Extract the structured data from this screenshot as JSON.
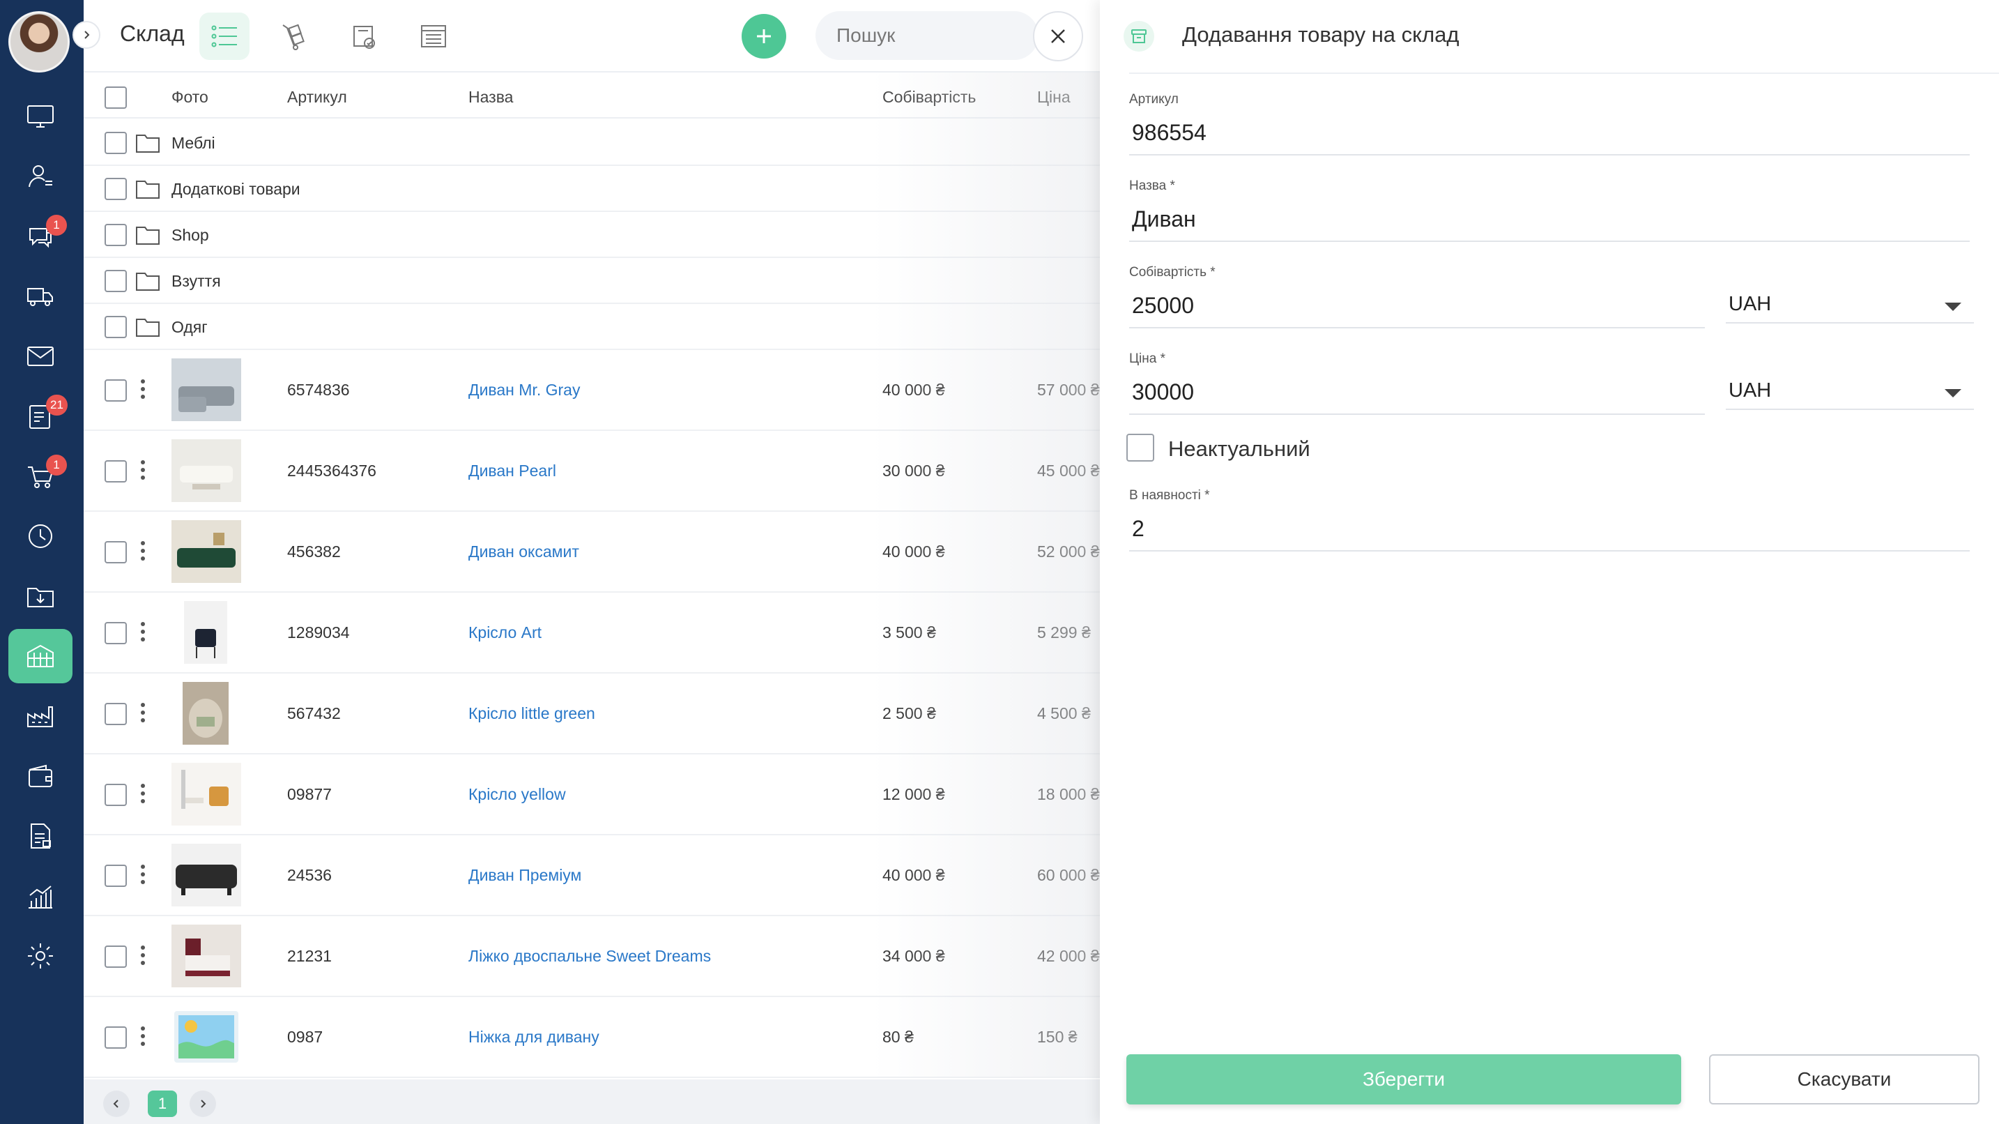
{
  "app": {
    "page_title": "Склад",
    "search_placeholder": "Пошук"
  },
  "sidebar": {
    "items": [
      {
        "icon": "monitor-icon",
        "badge": ""
      },
      {
        "icon": "contacts-icon",
        "badge": ""
      },
      {
        "icon": "chat-icon",
        "badge": "1"
      },
      {
        "icon": "delivery-truck-icon",
        "badge": ""
      },
      {
        "icon": "mail-icon",
        "badge": ""
      },
      {
        "icon": "notes-icon",
        "badge": "21"
      },
      {
        "icon": "cart-icon",
        "badge": "1"
      },
      {
        "icon": "clock-icon",
        "badge": ""
      },
      {
        "icon": "download-folder-icon",
        "badge": ""
      },
      {
        "icon": "warehouse-icon",
        "badge": "",
        "active": true
      },
      {
        "icon": "factory-icon",
        "badge": ""
      },
      {
        "icon": "wallet-icon",
        "badge": ""
      },
      {
        "icon": "documents-icon",
        "badge": ""
      },
      {
        "icon": "analytics-icon",
        "badge": ""
      },
      {
        "icon": "settings-icon",
        "badge": ""
      }
    ]
  },
  "table": {
    "headers": {
      "photo": "Фото",
      "sku": "Артикул",
      "name": "Назва",
      "cost": "Собівартість",
      "price": "Ціна"
    },
    "folders": [
      "Меблі",
      "Додаткові товари",
      "Shop",
      "Взуття",
      "Одяг"
    ],
    "items": [
      {
        "sku": "6574836",
        "name": "Диван Mr. Gray",
        "cost": "40 000 ₴",
        "price": "57 000 ₴"
      },
      {
        "sku": "2445364376",
        "name": "Диван Pearl",
        "cost": "30 000 ₴",
        "price": "45 000 ₴"
      },
      {
        "sku": "456382",
        "name": "Диван оксамит",
        "cost": "40 000 ₴",
        "price": "52 000 ₴"
      },
      {
        "sku": "1289034",
        "name": "Крісло Art",
        "cost": "3 500 ₴",
        "price": "5 299 ₴"
      },
      {
        "sku": "567432",
        "name": "Крісло little green",
        "cost": "2 500 ₴",
        "price": "4 500 ₴"
      },
      {
        "sku": "09877",
        "name": "Крісло yellow",
        "cost": "12 000 ₴",
        "price": "18 000 ₴"
      },
      {
        "sku": "24536",
        "name": "Диван Преміум",
        "cost": "40 000 ₴",
        "price": "60 000 ₴"
      },
      {
        "sku": "21231",
        "name": "Ліжко двоспальне Sweet Dreams",
        "cost": "34 000 ₴",
        "price": "42 000 ₴"
      },
      {
        "sku": "0987",
        "name": "Ніжка для дивану",
        "cost": "80 ₴",
        "price": "150 ₴"
      }
    ]
  },
  "pager": {
    "current": "1"
  },
  "panel": {
    "title": "Додавання товару на склад",
    "sku_label": "Артикул",
    "sku_value": "986554",
    "name_label": "Назва *",
    "name_value": "Диван",
    "cost_label": "Собівартість *",
    "cost_value": "25000",
    "cost_currency": "UAH",
    "price_label": "Ціна *",
    "price_value": "30000",
    "price_currency": "UAH",
    "inactive_label": "Неактуальний",
    "stock_label": "В наявності *",
    "stock_value": "2",
    "save_label": "Зберегти",
    "cancel_label": "Скасувати"
  },
  "colors": {
    "sidebar_bg": "#17325a",
    "accent_green": "#55c79a",
    "link_blue": "#2a78c8",
    "badge_red": "#e9534f"
  }
}
